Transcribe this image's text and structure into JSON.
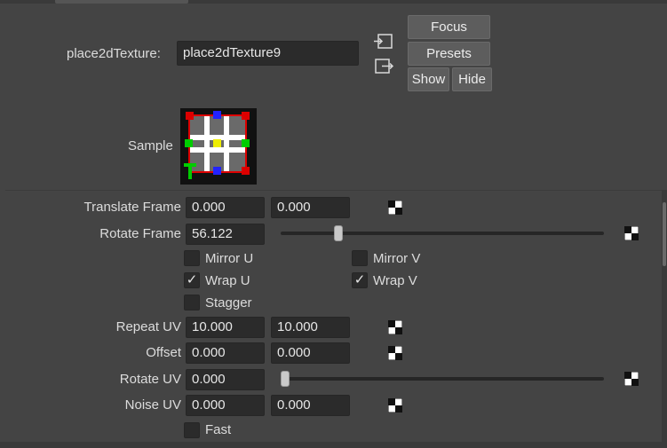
{
  "header": {
    "node_label": "place2dTexture:",
    "node_name": "place2dTexture9",
    "buttons": {
      "focus": "Focus",
      "presets": "Presets",
      "show": "Show",
      "hide": "Hide"
    }
  },
  "sample": {
    "label": "Sample"
  },
  "attributes": {
    "translate_frame": {
      "label": "Translate Frame",
      "u": "0.000",
      "v": "0.000"
    },
    "rotate_frame": {
      "label": "Rotate Frame",
      "value": "56.122",
      "slider_fraction": 0.17
    },
    "mirror_u": {
      "label": "Mirror U",
      "checked": false
    },
    "mirror_v": {
      "label": "Mirror V",
      "checked": false
    },
    "wrap_u": {
      "label": "Wrap U",
      "checked": true
    },
    "wrap_v": {
      "label": "Wrap V",
      "checked": true
    },
    "stagger": {
      "label": "Stagger",
      "checked": false
    },
    "repeat_uv": {
      "label": "Repeat UV",
      "u": "10.000",
      "v": "10.000"
    },
    "offset": {
      "label": "Offset",
      "u": "0.000",
      "v": "0.000"
    },
    "rotate_uv": {
      "label": "Rotate UV",
      "value": "0.000",
      "slider_fraction": 0.0
    },
    "noise_uv": {
      "label": "Noise UV",
      "u": "0.000",
      "v": "0.000"
    },
    "fast": {
      "label": "Fast",
      "checked": false
    }
  },
  "check_glyph": "✓",
  "colors": {
    "background": "#444444",
    "field": "#2b2b2b",
    "button": "#5d5d5d",
    "text": "#dcdcdc"
  }
}
